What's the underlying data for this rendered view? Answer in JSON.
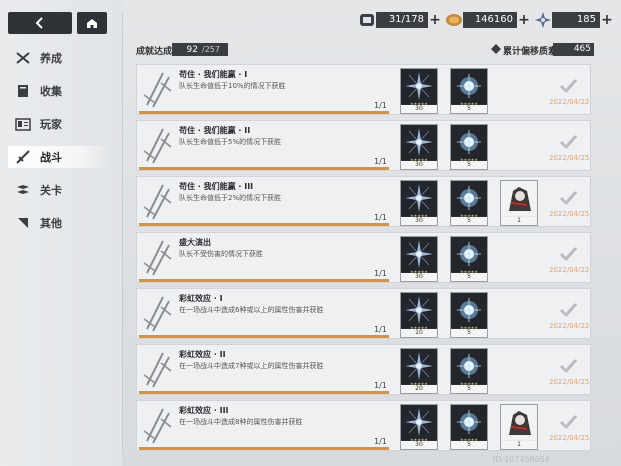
{
  "nav": {
    "items": [
      {
        "label": "养成",
        "icon": "crossed-swords-icon",
        "active": false
      },
      {
        "label": "收集",
        "icon": "book-icon",
        "active": false
      },
      {
        "label": "玩家",
        "icon": "id-card-icon",
        "active": false
      },
      {
        "label": "战斗",
        "icon": "target-sword-icon",
        "active": true
      },
      {
        "label": "关卡",
        "icon": "flag-icon",
        "active": false
      },
      {
        "label": "其他",
        "icon": "corner-icon",
        "active": false
      }
    ]
  },
  "resources": {
    "stamina": {
      "value": "31/178",
      "icon": "stamina-icon"
    },
    "coins": {
      "value": "146160",
      "icon": "coin-icon"
    },
    "crystals": {
      "value": "185",
      "icon": "crystal-icon"
    }
  },
  "progress": {
    "label": "成就达成",
    "current": "92",
    "total": "/257"
  },
  "essence": {
    "label": "累计偏移质素",
    "value": "465"
  },
  "achievements": [
    {
      "title": "苟住 · 我们能赢 · I",
      "desc": "队长生命值低于10%的情况下获胜",
      "count": "1/1",
      "rewards": [
        {
          "type": "crystal",
          "qty": "30"
        },
        {
          "type": "orb",
          "qty": "5"
        }
      ],
      "date": "2022/04/22"
    },
    {
      "title": "苟住 · 我们能赢 · II",
      "desc": "队长生命值低于5%的情况下获胜",
      "count": "1/1",
      "rewards": [
        {
          "type": "crystal",
          "qty": "30"
        },
        {
          "type": "orb",
          "qty": "5"
        }
      ],
      "date": "2022/04/25"
    },
    {
      "title": "苟住 · 我们能赢 · III",
      "desc": "队长生命值低于2%的情况下获胜",
      "count": "1/1",
      "rewards": [
        {
          "type": "crystal",
          "qty": "30"
        },
        {
          "type": "orb",
          "qty": "5"
        },
        {
          "type": "char",
          "qty": "1"
        }
      ],
      "date": "2022/04/25"
    },
    {
      "title": "盛大演出",
      "desc": "队长不受伤害的情况下获胜",
      "count": "1/1",
      "rewards": [
        {
          "type": "crystal",
          "qty": "30"
        },
        {
          "type": "orb",
          "qty": "5"
        }
      ],
      "date": "2022/04/22"
    },
    {
      "title": "彩虹效应 · I",
      "desc": "在一场战斗中造成6种或以上的属性伤害并获胜",
      "count": "1/1",
      "rewards": [
        {
          "type": "crystal",
          "qty": "10"
        },
        {
          "type": "orb",
          "qty": "5"
        }
      ],
      "date": "2022/04/22"
    },
    {
      "title": "彩虹效应 · II",
      "desc": "在一场战斗中造成7种或以上的属性伤害并获胜",
      "count": "1/1",
      "rewards": [
        {
          "type": "crystal",
          "qty": "20"
        },
        {
          "type": "orb",
          "qty": "5"
        }
      ],
      "date": "2022/04/25"
    },
    {
      "title": "彩虹效应 · III",
      "desc": "在一场战斗中造成8种的属性伤害并获胜",
      "count": "1/1",
      "rewards": [
        {
          "type": "crystal",
          "qty": "30"
        },
        {
          "type": "orb",
          "qty": "5"
        },
        {
          "type": "char",
          "qty": "1"
        }
      ],
      "date": "2022/04/25"
    }
  ],
  "uid": "ID:107458056",
  "colors": {
    "progress": "#f08c1a",
    "date": "#e6a36a",
    "panel": "#3a3d42"
  }
}
